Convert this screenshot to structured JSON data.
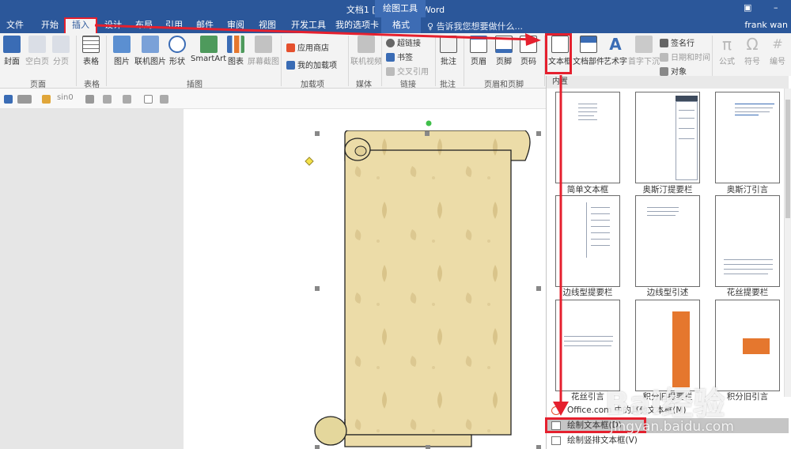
{
  "window": {
    "title": "文档1 [兼容模式] - Word",
    "contextual_group": "绘图工具",
    "user": "frank wan"
  },
  "tabs": [
    {
      "label": "文件"
    },
    {
      "label": "开始"
    },
    {
      "label": "插入"
    },
    {
      "label": "设计"
    },
    {
      "label": "布局"
    },
    {
      "label": "引用"
    },
    {
      "label": "邮件"
    },
    {
      "label": "审阅"
    },
    {
      "label": "视图"
    },
    {
      "label": "开发工具"
    },
    {
      "label": "我的选项卡"
    },
    {
      "label": "格式"
    }
  ],
  "tell_me": "告诉我您想要做什么...",
  "ribbon": {
    "buttons": {
      "cover": "封面",
      "blank_page": "空白页",
      "page_break": "分页",
      "table": "表格",
      "picture": "图片",
      "online_picture": "联机图片",
      "shapes": "形状",
      "smartart": "SmartArt",
      "chart": "图表",
      "screenshot": "屏幕截图",
      "store": "应用商店",
      "my_addins": "我的加载项",
      "online_video": "联机视频",
      "hyperlink": "超链接",
      "bookmark": "书签",
      "cross_ref": "交叉引用",
      "comment": "批注",
      "header": "页眉",
      "footer": "页脚",
      "page_number": "页码",
      "textbox": "文本框",
      "quick_parts": "文档部件",
      "wordart": "艺术字",
      "dropcap": "首字下沉",
      "signature": "签名行",
      "datetime": "日期和时间",
      "object": "对象",
      "equation": "公式",
      "symbol": "符号",
      "number": "编号"
    },
    "groups": {
      "pages": "页面",
      "tables": "表格",
      "illustrations": "插图",
      "addins": "加载项",
      "media": "媒体",
      "links": "链接",
      "comments": "批注",
      "header_footer": "页眉和页脚"
    }
  },
  "quick_toolbar": {
    "font_size": "sin0"
  },
  "gallery": {
    "header": "内置",
    "items": [
      {
        "label": "简单文本框"
      },
      {
        "label": "奥斯汀提要栏"
      },
      {
        "label": "奥斯汀引言"
      },
      {
        "label": "边线型提要栏"
      },
      {
        "label": "边线型引述"
      },
      {
        "label": "花丝提要栏"
      },
      {
        "label": "花丝引言"
      },
      {
        "label": "积分旧提要栏"
      },
      {
        "label": "积分旧引言"
      }
    ],
    "menu": [
      {
        "label": "Office.com 中的其他文本框(M)"
      },
      {
        "label": "绘制文本框(D)"
      },
      {
        "label": "绘制竖排文本框(V)"
      }
    ]
  },
  "watermark": {
    "text": "Bai经验",
    "url": "jingyan.baidu.com"
  },
  "colors": {
    "word_blue": "#2b579a",
    "accent_red": "#e5202e",
    "parchment": "#ecdca8",
    "orange": "#e5772e"
  }
}
